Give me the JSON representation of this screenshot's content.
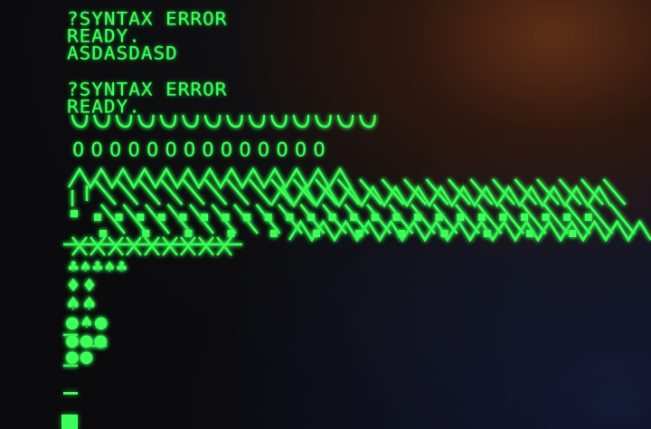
{
  "screen": {
    "text_color": "#3cff5a",
    "lines": [
      "?SYNTAX ERROR",
      "READY.",
      "ASDASDASD",
      "?SYNTAX ERROR",
      "READY."
    ],
    "circle_row": "O O O O O O O O O O O O O O",
    "suit_rows": {
      "clubs_spades": "♣♠♣♠♣",
      "diamonds": "♦♦",
      "spades": "♠♠",
      "mixed": "●♠●"
    }
  }
}
